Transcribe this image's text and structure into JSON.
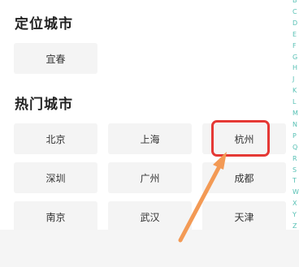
{
  "location": {
    "title": "定位城市",
    "city": "宜春"
  },
  "hot": {
    "title": "热门城市",
    "cities": [
      "北京",
      "上海",
      "杭州",
      "深圳",
      "广州",
      "成都",
      "南京",
      "武汉",
      "天津"
    ]
  },
  "index": {
    "letters": [
      "B",
      "C",
      "D",
      "E",
      "F",
      "G",
      "H",
      "J",
      "K",
      "L",
      "M",
      "N",
      "P",
      "Q",
      "R",
      "S",
      "T",
      "W",
      "X",
      "Y",
      "Z"
    ]
  },
  "colors": {
    "highlight": "#e53935",
    "arrow": "#f39a55",
    "index": "#56c0b4"
  }
}
